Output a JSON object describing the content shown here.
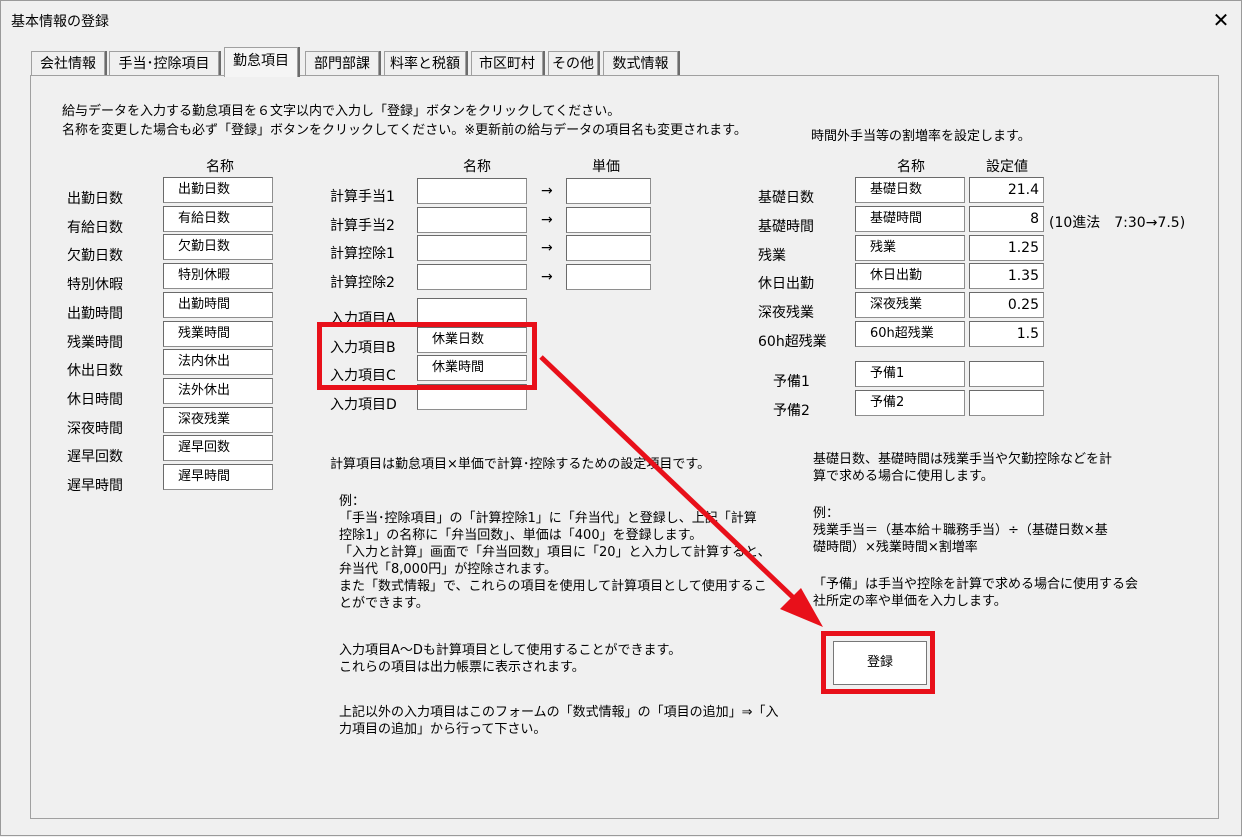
{
  "window": {
    "title": "基本情報の登録",
    "close_label": "✕"
  },
  "tabs": [
    {
      "label": "会社情報"
    },
    {
      "label": "手当･控除項目"
    },
    {
      "label": "勤怠項目"
    },
    {
      "label": "部門部課"
    },
    {
      "label": "料率と税額"
    },
    {
      "label": "市区町村"
    },
    {
      "label": "その他"
    },
    {
      "label": "数式情報"
    }
  ],
  "intro": {
    "line1": "給与データを入力する勤怠項目を６文字以内で入力し「登録」ボタンをクリックしてください。",
    "line2": "名称を変更した場合も必ず「登録」ボタンをクリックしてください。※更新前の給与データの項目名も変更されます。"
  },
  "left": {
    "header": "名称",
    "rows": [
      {
        "label": "出勤日数",
        "value": "出勤日数"
      },
      {
        "label": "有給日数",
        "value": "有給日数"
      },
      {
        "label": "欠勤日数",
        "value": "欠勤日数"
      },
      {
        "label": "特別休暇",
        "value": "特別休暇"
      },
      {
        "label": "出勤時間",
        "value": "出勤時間"
      },
      {
        "label": "残業時間",
        "value": "残業時間"
      },
      {
        "label": "休出日数",
        "value": "法内休出"
      },
      {
        "label": "休日時間",
        "value": "法外休出"
      },
      {
        "label": "深夜時間",
        "value": "深夜残業"
      },
      {
        "label": "遅早回数",
        "value": "遅早回数"
      },
      {
        "label": "遅早時間",
        "value": "遅早時間"
      }
    ]
  },
  "middle": {
    "name_header": "名称",
    "price_header": "単価",
    "arrow": "→",
    "calc_rows": [
      {
        "label": "計算手当1",
        "name": "",
        "price": ""
      },
      {
        "label": "計算手当2",
        "name": "",
        "price": ""
      },
      {
        "label": "計算控除1",
        "name": "",
        "price": ""
      },
      {
        "label": "計算控除2",
        "name": "",
        "price": ""
      }
    ],
    "input_rows": [
      {
        "label": "入力項目A",
        "value": ""
      },
      {
        "label": "入力項目B",
        "value": "休業日数"
      },
      {
        "label": "入力項目C",
        "value": "休業時間"
      },
      {
        "label": "入力項目D",
        "value": ""
      }
    ],
    "note1": "計算項目は勤怠項目×単価で計算･控除するための設定項目です。",
    "note2": "例：\n「手当･控除項目」の「計算控除1」に「弁当代」と登録し、上記「計算\n控除1」の名称に「弁当回数」、単価は「400」を登録します。\n「入力と計算」画面で「弁当回数」項目に「20」と入力して計算すると、\n弁当代「8,000円」が控除されます。\nまた「数式情報」で、これらの項目を使用して計算項目として使用するこ\nとができます。",
    "note3": "入力項目A～Dも計算項目として使用することができます。\nこれらの項目は出力帳票に表示されます。",
    "note4": "上記以外の入力項目はこのフォームの「数式情報」の「項目の追加」⇒「入\n力項目の追加」から行って下さい。"
  },
  "right": {
    "caption": "時間外手当等の割増率を設定します。",
    "name_header": "名称",
    "value_header": "設定値",
    "rows": [
      {
        "label": "基礎日数",
        "name": "基礎日数",
        "value": "21.4"
      },
      {
        "label": "基礎時間",
        "name": "基礎時間",
        "value": "8"
      },
      {
        "label": "残業",
        "name": "残業",
        "value": "1.25"
      },
      {
        "label": "休日出勤",
        "name": "休日出勤",
        "value": "1.35"
      },
      {
        "label": "深夜残業",
        "name": "深夜残業",
        "value": "0.25"
      },
      {
        "label": "60h超残業",
        "name": "60h超残業",
        "value": "1.5"
      }
    ],
    "time_note": "(10進法　7:30→7.5)",
    "spare_rows": [
      {
        "label": "予備1",
        "name": "予備1",
        "value": ""
      },
      {
        "label": "予備2",
        "name": "予備2",
        "value": ""
      }
    ],
    "note1": "基礎日数、基礎時間は残業手当や欠勤控除などを計\n算で求める場合に使用します。",
    "note2": "例：\n残業手当＝（基本給＋職務手当）÷（基礎日数×基\n礎時間）×残業時間×割増率",
    "note3": "「予備」は手当や控除を計算で求める場合に使用する会\n社所定の率や単価を入力します。",
    "register_label": "登録"
  },
  "colors": {
    "highlight": "#e8101a"
  }
}
